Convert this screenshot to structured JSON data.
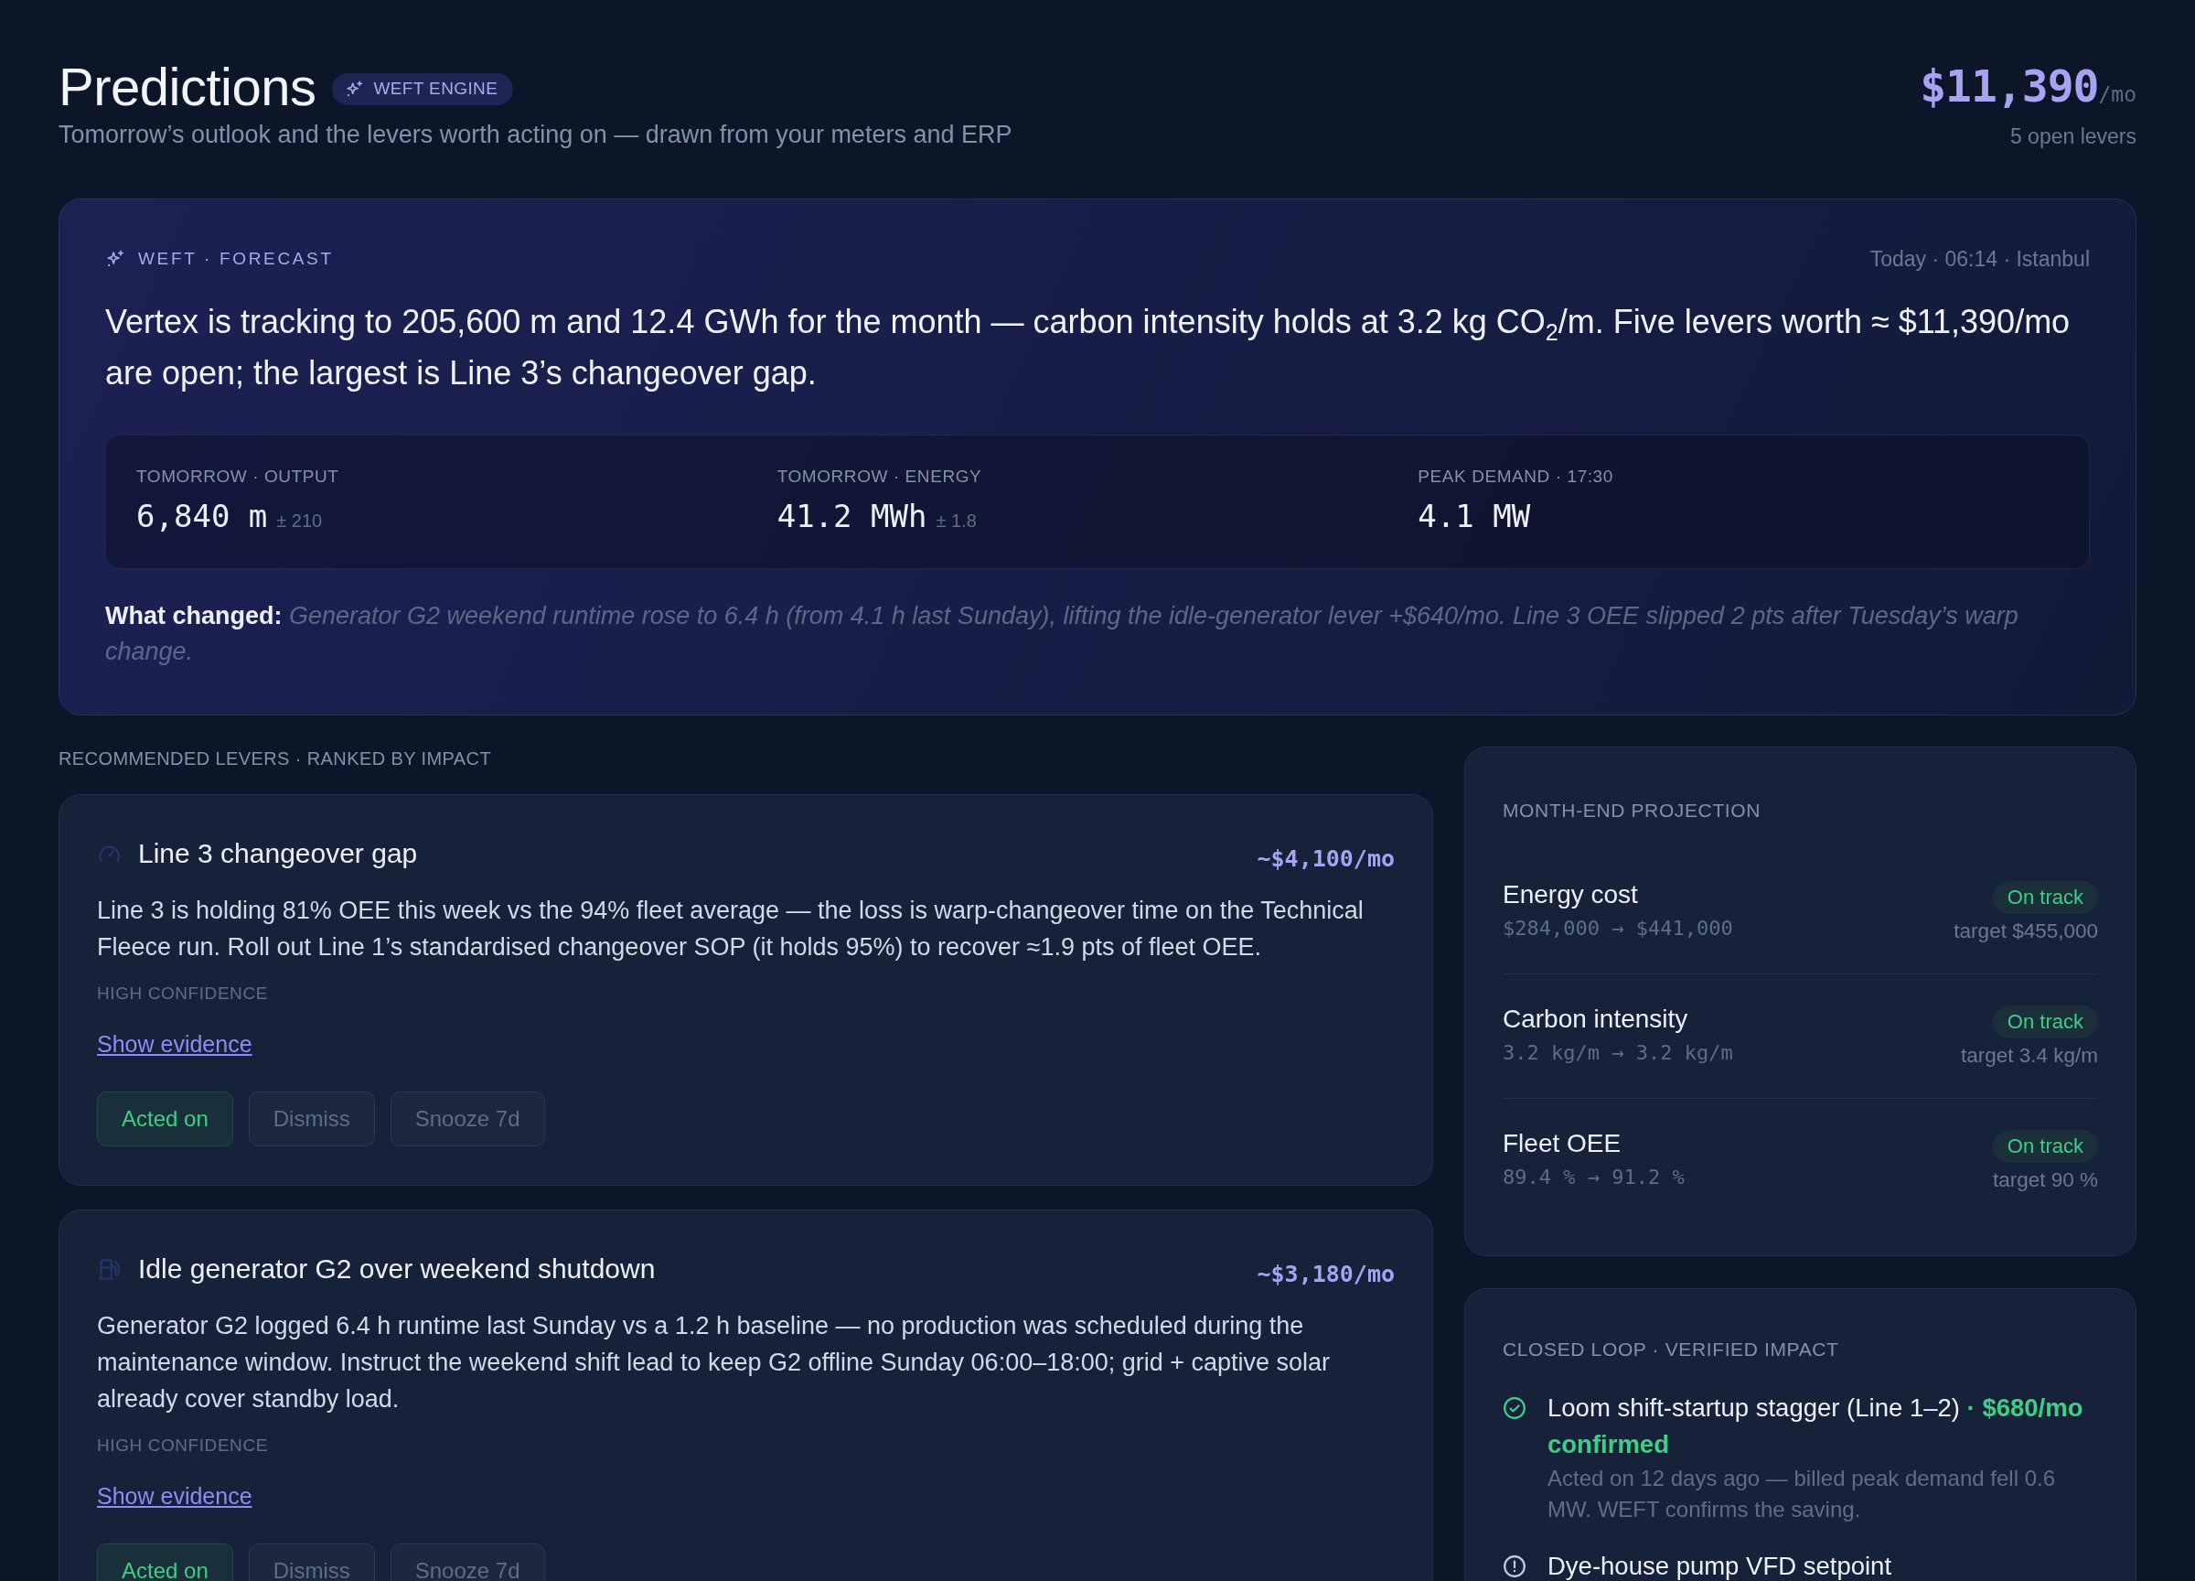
{
  "header": {
    "title": "Predictions",
    "badge": "WEFT ENGINE",
    "subtitle": "Tomorrow’s outlook and the levers worth acting on — drawn from your meters and ERP",
    "total": {
      "value": "$11,390",
      "unit": "/mo",
      "caption": "5 open levers"
    }
  },
  "forecast": {
    "label": "WEFT · FORECAST",
    "timestamp": "Today · 06:14 · Istanbul",
    "summary": "Vertex is tracking to 205,600 m and 12.4 GWh for the month — carbon intensity holds at 3.2 kg CO$_{2}$/m. Five levers worth ≈ $11,390/mo are open; the largest is Line 3’s changeover gap.",
    "stats": [
      {
        "label": "TOMORROW · OUTPUT",
        "value": "6,840 m",
        "range": "± 210"
      },
      {
        "label": "TOMORROW · ENERGY",
        "value": "41.2 MWh",
        "range": "± 1.8"
      },
      {
        "label": "PEAK DEMAND · 17:30",
        "value": "4.1 MW"
      }
    ],
    "what_changed": "**What changed:** *Generator G2 weekend runtime rose to 6.4 h (from 4.1 h last Sunday), lifting the idle-generator lever +$640/mo. Line 3 OEE slipped 2 pts after Tuesday’s warp change.*"
  },
  "levers": {
    "heading": "RECOMMENDED LEVERS · RANKED BY IMPACT",
    "items": [
      {
        "kind": "line",
        "title": "Line 3 changeover gap",
        "impact": "~$4,100/mo",
        "description": "Line 3 is holding 81% OEE this week vs the 94% fleet average — the loss is warp-changeover time on the Technical Fleece run. Roll out Line 1’s standardised changeover SOP (it holds 95%) to recover ≈1.9 pts of fleet OEE.",
        "confidence": "HIGH CONFIDENCE",
        "link": "Show evidence",
        "actions": [
          {
            "label": "Acted on",
            "kind": "positive"
          },
          {
            "label": "Dismiss",
            "kind": "neutral"
          },
          {
            "label": "Snooze 7d",
            "kind": "neutral"
          }
        ]
      },
      {
        "kind": "generator",
        "title": "Idle generator G2 over weekend shutdown",
        "impact": "~$3,180/mo",
        "description": "Generator G2 logged 6.4 h runtime last Sunday vs a 1.2 h baseline — no production was scheduled during the maintenance window. Instruct the weekend shift lead to keep G2 offline Sunday 06:00–18:00; grid + captive solar already cover standby load.",
        "confidence": "HIGH CONFIDENCE",
        "link": "Show evidence",
        "actions": [
          {
            "label": "Acted on",
            "kind": "positive"
          },
          {
            "label": "Dismiss",
            "kind": "neutral"
          },
          {
            "label": "Snooze 7d",
            "kind": "neutral"
          }
        ]
      }
    ]
  },
  "projection": {
    "heading": "MONTH-END PROJECTION",
    "rows": [
      {
        "label": "Energy cost",
        "projection": "$284,000 → $441,000",
        "status": "On track",
        "target": "target $455,000"
      },
      {
        "label": "Carbon intensity",
        "projection": "3.2 kg/m → 3.2 kg/m",
        "status": "On track",
        "target": "target 3.4 kg/m"
      },
      {
        "label": "Fleet OEE",
        "projection": "89.4 % → 91.2 %",
        "status": "On track",
        "target": "target 90 %"
      }
    ]
  },
  "closed_loop": {
    "heading": "CLOSED LOOP · VERIFIED IMPACT",
    "items": [
      {
        "kind": "verified",
        "title": "Loom shift-startup stagger (Line 1–2) **· $680/mo confirmed**",
        "note": "Acted on 12 days ago — billed peak demand fell 0.6 MW. WEFT confirms the saving."
      },
      {
        "kind": "attention",
        "title": "Dye-house pump VFD setpoint"
      }
    ]
  }
}
